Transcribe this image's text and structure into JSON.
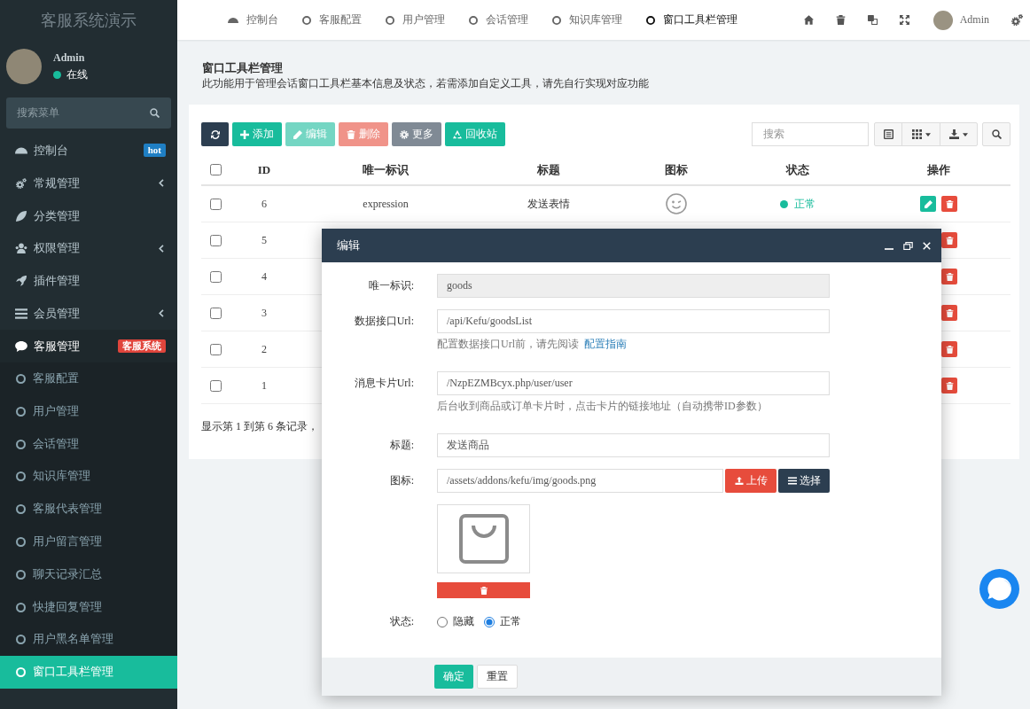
{
  "sidebar": {
    "title": "客服系统演示",
    "user": {
      "name": "Admin",
      "status": "在线"
    },
    "search": {
      "placeholder": "搜索菜单"
    },
    "items": [
      {
        "label": "控制台",
        "selected": false,
        "collapsed": false,
        "badge": {
          "text": "hot",
          "color": "#1f7fc4"
        }
      },
      {
        "label": "常规管理",
        "selected": false,
        "collapsed": true
      },
      {
        "label": "分类管理",
        "selected": false,
        "collapsed": false
      },
      {
        "label": "权限管理",
        "selected": false,
        "collapsed": true
      },
      {
        "label": "插件管理",
        "selected": false,
        "collapsed": false
      },
      {
        "label": "会员管理",
        "selected": false,
        "collapsed": true
      },
      {
        "label": "客服管理",
        "selected": true,
        "collapsed": false,
        "badge": {
          "text": "客服系统",
          "color": "#e0453c"
        },
        "children": [
          {
            "label": "客服配置",
            "selected": false
          },
          {
            "label": "用户管理",
            "selected": false
          },
          {
            "label": "会话管理",
            "selected": false
          },
          {
            "label": "知识库管理",
            "selected": false
          },
          {
            "label": "客服代表管理",
            "selected": false
          },
          {
            "label": "用户留言管理",
            "selected": false
          },
          {
            "label": "聊天记录汇总",
            "selected": false
          },
          {
            "label": "快捷回复管理",
            "selected": false
          },
          {
            "label": "用户黑名单管理",
            "selected": false
          },
          {
            "label": "窗口工具栏管理",
            "selected": true
          }
        ]
      }
    ]
  },
  "topnav": {
    "tabs": [
      {
        "label": "控制台",
        "selected": false
      },
      {
        "label": "客服配置",
        "selected": false
      },
      {
        "label": "用户管理",
        "selected": false
      },
      {
        "label": "会话管理",
        "selected": false
      },
      {
        "label": "知识库管理",
        "selected": false
      },
      {
        "label": "窗口工具栏管理",
        "selected": true
      }
    ],
    "user": "Admin"
  },
  "page": {
    "title": "窗口工具栏管理",
    "description": "此功能用于管理会话窗口工具栏基本信息及状态，若需添加自定义工具，请先自行实现对应功能"
  },
  "toolbar": {
    "buttons": [
      {
        "label": "添加",
        "kind": "success",
        "disabled": false
      },
      {
        "label": "编辑",
        "kind": "success",
        "disabled": true
      },
      {
        "label": "删除",
        "kind": "danger",
        "disabled": true
      },
      {
        "label": "更多",
        "kind": "dark",
        "disabled": true
      },
      {
        "label": "回收站",
        "kind": "success",
        "disabled": false
      }
    ],
    "search": {
      "placeholder": "搜索"
    }
  },
  "table": {
    "all_checked": false,
    "columns": [
      "ID",
      "唯一标识",
      "标题",
      "图标",
      "状态",
      "操作"
    ],
    "rows": [
      {
        "checked": false,
        "id": "6",
        "key": "expression",
        "title": "发送表情",
        "status": "正常",
        "actions": [
          {
            "kind": "edit"
          },
          {
            "kind": "delete"
          }
        ]
      },
      {
        "checked": false,
        "id": "5",
        "actions": [
          {
            "kind": "delete"
          }
        ]
      },
      {
        "checked": false,
        "id": "4",
        "actions": [
          {
            "kind": "delete"
          }
        ]
      },
      {
        "checked": false,
        "id": "3",
        "actions": [
          {
            "kind": "delete"
          }
        ]
      },
      {
        "checked": false,
        "id": "2",
        "actions": [
          {
            "kind": "delete"
          }
        ]
      },
      {
        "checked": false,
        "id": "1",
        "actions": [
          {
            "kind": "delete"
          }
        ]
      }
    ],
    "summary": "显示第 1 到第 6 条记录，"
  },
  "modal": {
    "title": "编辑",
    "fields": [
      {
        "kind": "text",
        "label": "唯一标识:",
        "value": "goods",
        "readonly": true
      },
      {
        "kind": "text",
        "label": "数据接口Url:",
        "value": "/api/Kefu/goodsList",
        "readonly": false,
        "help": "配置数据接口Url前，请先阅读",
        "help_link": "配置指南"
      },
      {
        "kind": "text",
        "label": "消息卡片Url:",
        "value": "/NzpEZMBcyx.php/user/user",
        "readonly": false,
        "help": "后台收到商品或订单卡片时，点击卡片的链接地址（自动携带ID参数）"
      },
      {
        "kind": "text",
        "label": "标题:",
        "value": "发送商品",
        "readonly": false
      },
      {
        "kind": "image",
        "label": "图标:",
        "value": "/assets/addons/kefu/img/goods.png",
        "buttons": [
          {
            "label": "上传",
            "kind": "danger"
          },
          {
            "label": "选择",
            "kind": "dark"
          }
        ]
      },
      {
        "kind": "radio",
        "label": "状态:",
        "options": [
          {
            "label": "隐藏",
            "selected": false
          },
          {
            "label": "正常",
            "selected": true
          }
        ]
      }
    ],
    "buttons": [
      {
        "label": "确定",
        "kind": "success"
      },
      {
        "label": "重置",
        "kind": "default"
      }
    ]
  }
}
